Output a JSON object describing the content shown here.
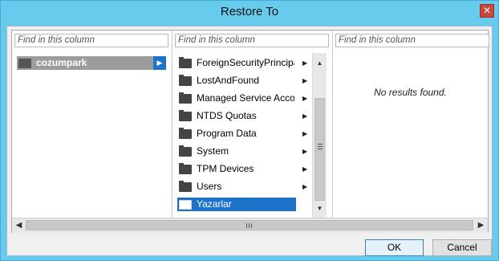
{
  "window": {
    "title": "Restore To"
  },
  "columns": [
    {
      "search_placeholder": "Find in this column",
      "items": [
        {
          "label": "cozumpark"
        }
      ]
    },
    {
      "search_placeholder": "Find in this column",
      "items": [
        {
          "label": "ForeignSecurityPrincipals"
        },
        {
          "label": "LostAndFound"
        },
        {
          "label": "Managed Service Accounts"
        },
        {
          "label": "NTDS Quotas"
        },
        {
          "label": "Program Data"
        },
        {
          "label": "System"
        },
        {
          "label": "TPM Devices"
        },
        {
          "label": "Users"
        },
        {
          "label": "Yazarlar"
        }
      ]
    },
    {
      "search_placeholder": "Find in this column",
      "empty_text": "No results found."
    }
  ],
  "buttons": {
    "ok": "OK",
    "cancel": "Cancel"
  },
  "colors": {
    "title_bar": "#67cbee",
    "selection": "#1c73c9",
    "close_button": "#c9483c"
  }
}
